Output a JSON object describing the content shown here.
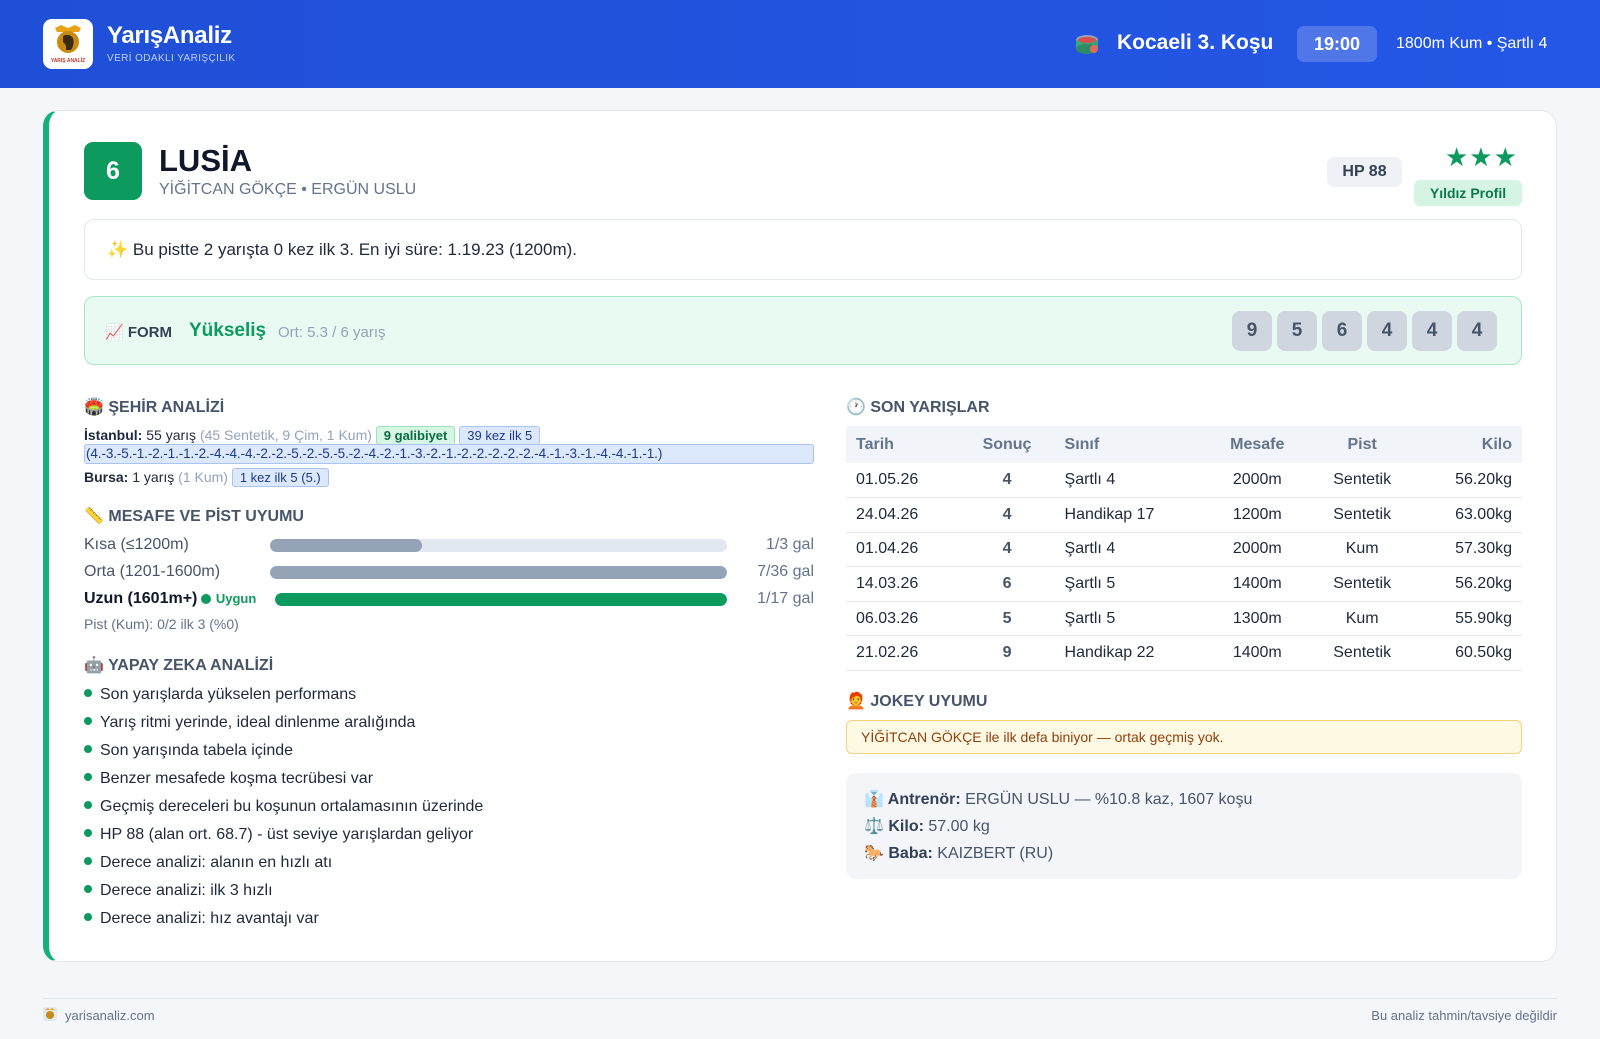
{
  "header": {
    "brand": "YarışAnaliz",
    "tagline": "VERİ ODAKLI YARIŞÇILIK",
    "logo_text": "YARIŞ ANALİZ",
    "race_title": "Kocaeli 3. Koşu",
    "time": "19:00",
    "race_meta": "1800m Kum • Şartlı 4"
  },
  "horse": {
    "number": "6",
    "name": "LUSİA",
    "subtitle": "YİĞİTCAN GÖKÇE • ERGÜN USLU",
    "hp": "HP 88",
    "stars": "★★★",
    "star_count": 3,
    "star_label": "Yıldız Profil"
  },
  "note": "✨ Bu pistte 2 yarışta 0 kez ilk 3. En iyi süre: 1.19.23 (1200m).",
  "form": {
    "label": "📈 FORM",
    "trend": "Yükseliş",
    "avg": "Ort: 5.3 / 6 yarış",
    "results": [
      "9",
      "5",
      "6",
      "4",
      "4",
      "4"
    ]
  },
  "city": {
    "title": "🏟️ ŞEHİR ANALİZİ",
    "istanbul": {
      "name": "İstanbul:",
      "races": "55 yarış",
      "detail": "(45 Sentetik, 9 Çim, 1 Kum)",
      "wins": "9 galibiyet",
      "top5": "39 kez ilk 5",
      "sequence": "(4.-3.-5.-1.-2.-1.-1.-2.-4.-4.-4.-2.-2.-5.-2.-5.-5.-2.-4.-2.-1.-3.-2.-1.-2.-2.-2.-2.-2.-4.-1.-3.-1.-4.-4.-1.-1.)"
    },
    "bursa": {
      "name": "Bursa:",
      "races": "1 yarış",
      "detail": "(1 Kum)",
      "top5": "1 kez ilk 5 (5.)"
    }
  },
  "distance": {
    "title": "📏 MESAFE VE PİST UYUMU",
    "rows": [
      {
        "label": "Kısa (≤1200m)",
        "value": "1/3 gal",
        "fraction": 0.333
      },
      {
        "label": "Orta (1201-1600m)",
        "value": "7/36 gal",
        "fraction": 1.0
      },
      {
        "label": "Uzun (1601m+)",
        "value": "1/17 gal",
        "fraction": 1.0,
        "badge": "Uygun"
      }
    ],
    "pist": "Pist (Kum): 0/2 ilk 3 (%0)"
  },
  "ai": {
    "title": "🤖 YAPAY ZEKA ANALİZİ",
    "items": [
      "Son yarışlarda yükselen performans",
      "Yarış ritmi yerinde, ideal dinlenme aralığında",
      "Son yarışında tabela içinde",
      "Benzer mesafede koşma tecrübesi var",
      "Geçmiş dereceleri bu koşunun ortalamasının üzerinde",
      "HP 88 (alan ort. 68.7) - üst seviye yarışlardan geliyor",
      "Derece analizi: alanın en hızlı atı",
      "Derece analizi: ilk 3 hızlı",
      "Derece analizi: hız avantajı var"
    ]
  },
  "recent": {
    "title": "🕐 SON YARIŞLAR",
    "headers": [
      "Tarih",
      "Sonuç",
      "Sınıf",
      "Mesafe",
      "Pist",
      "Kilo"
    ],
    "rows": [
      [
        "01.05.26",
        "4",
        "Şartlı 4",
        "2000m",
        "Sentetik",
        "56.20kg"
      ],
      [
        "24.04.26",
        "4",
        "Handikap 17",
        "1200m",
        "Sentetik",
        "63.00kg"
      ],
      [
        "01.04.26",
        "4",
        "Şartlı 4",
        "2000m",
        "Kum",
        "57.30kg"
      ],
      [
        "14.03.26",
        "6",
        "Şartlı 5",
        "1400m",
        "Sentetik",
        "56.20kg"
      ],
      [
        "06.03.26",
        "5",
        "Şartlı 5",
        "1300m",
        "Kum",
        "55.90kg"
      ],
      [
        "21.02.26",
        "9",
        "Handikap 22",
        "1400m",
        "Sentetik",
        "60.50kg"
      ]
    ]
  },
  "jokey": {
    "title": "🧑‍🦰 JOKEY UYUMU",
    "text": "YİĞİTCAN GÖKÇE ile ilk defa biniyor — ortak geçmiş yok."
  },
  "info": {
    "trainer_label": "👔 Antrenör:",
    "trainer_value": "ERGÜN USLU — %10.8 kaz, 1607 koşu",
    "weight_label": "⚖️ Kilo:",
    "weight_value": "57.00 kg",
    "sire_label": "🐎 Baba:",
    "sire_value": "KAIZBERT (RU)"
  },
  "footer": {
    "site": "yarisanaliz.com",
    "disclaimer": "Bu analiz tahmin/tavsiye değildir"
  },
  "colors": {
    "header_blue": "#2457e6",
    "accent_green": "#0c9a5f",
    "form_bg": "#e9faf2",
    "jokey_bg": "#fef9e3"
  }
}
